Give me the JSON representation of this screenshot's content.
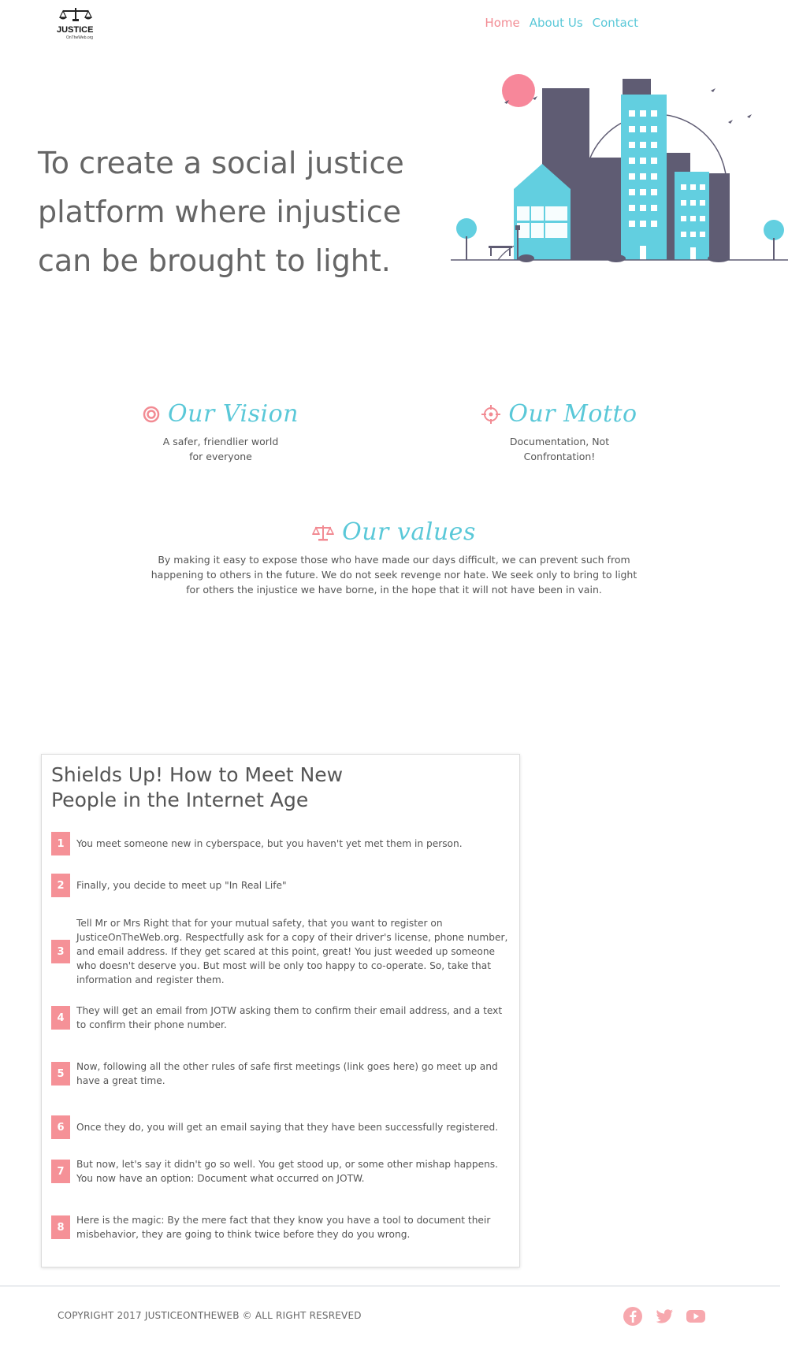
{
  "brand": {
    "logo_text": "JUSTICE",
    "logo_subtext": "OnTheWeb.org"
  },
  "nav": {
    "items": [
      {
        "label": "Home",
        "active": true
      },
      {
        "label": "About Us",
        "active": false
      },
      {
        "label": "Contact",
        "active": false
      }
    ]
  },
  "hero": {
    "title": "To create a social justice platform where injustice can be brought to light."
  },
  "vision": {
    "title": "Our Vision",
    "text": "A safer, friendlier world for everyone"
  },
  "motto": {
    "title": "Our Motto",
    "text": "Documentation, Not Confrontation!"
  },
  "values": {
    "title": "Our values",
    "text": "By making it easy to expose those who have made our days difficult, we can prevent such from happening to others in the future. We do not seek revenge nor hate. We seek only to bring to light for others the injustice we have borne, in the hope that it will not have been in vain."
  },
  "guide": {
    "title": "Shields Up! How to Meet New People in the Internet Age",
    "steps": [
      {
        "num": "1",
        "text": "You meet someone new in cyberspace, but you haven't yet met them in person."
      },
      {
        "num": "2",
        "text": "Finally, you decide to meet up \"In Real Life\""
      },
      {
        "num": "3",
        "text": "Tell Mr or Mrs Right that for your mutual safety, that you want to register on JusticeOnTheWeb.org. Respectfully ask for a copy of their driver's license, phone number, and email address. If they get scared at this point, great! You just weeded up someone who doesn't deserve you. But most will be only too happy to co-operate. So, take that information and register them."
      },
      {
        "num": "4",
        "text": "They will get an email from JOTW asking them to confirm their email address, and a text to confirm their phone number."
      },
      {
        "num": "5",
        "text": "Now, following all the other rules of safe first meetings (link goes here) go meet up and have a great time."
      },
      {
        "num": "6",
        "text": "Once they do, you will get an email saying that they have been successfully registered."
      },
      {
        "num": "7",
        "text": "But now, let's say it didn't go so well. You get stood up, or some other mishap happens. You now have an option: Document what occurred on JOTW."
      },
      {
        "num": "8",
        "text": "Here is the magic: By the mere fact that they know you have a tool to document their misbehavior, they are going to think twice before they do you wrong."
      }
    ]
  },
  "footer": {
    "copyright": "COPYRIGHT 2017 JUSTICEONTHEWEB © ALL RIGHT RESREVED",
    "socials": [
      "facebook-icon",
      "twitter-icon",
      "youtube-icon"
    ]
  },
  "colors": {
    "accent_teal": "#5ac8d8",
    "accent_pink": "#f28b93",
    "building_dark": "#5f5c73"
  }
}
